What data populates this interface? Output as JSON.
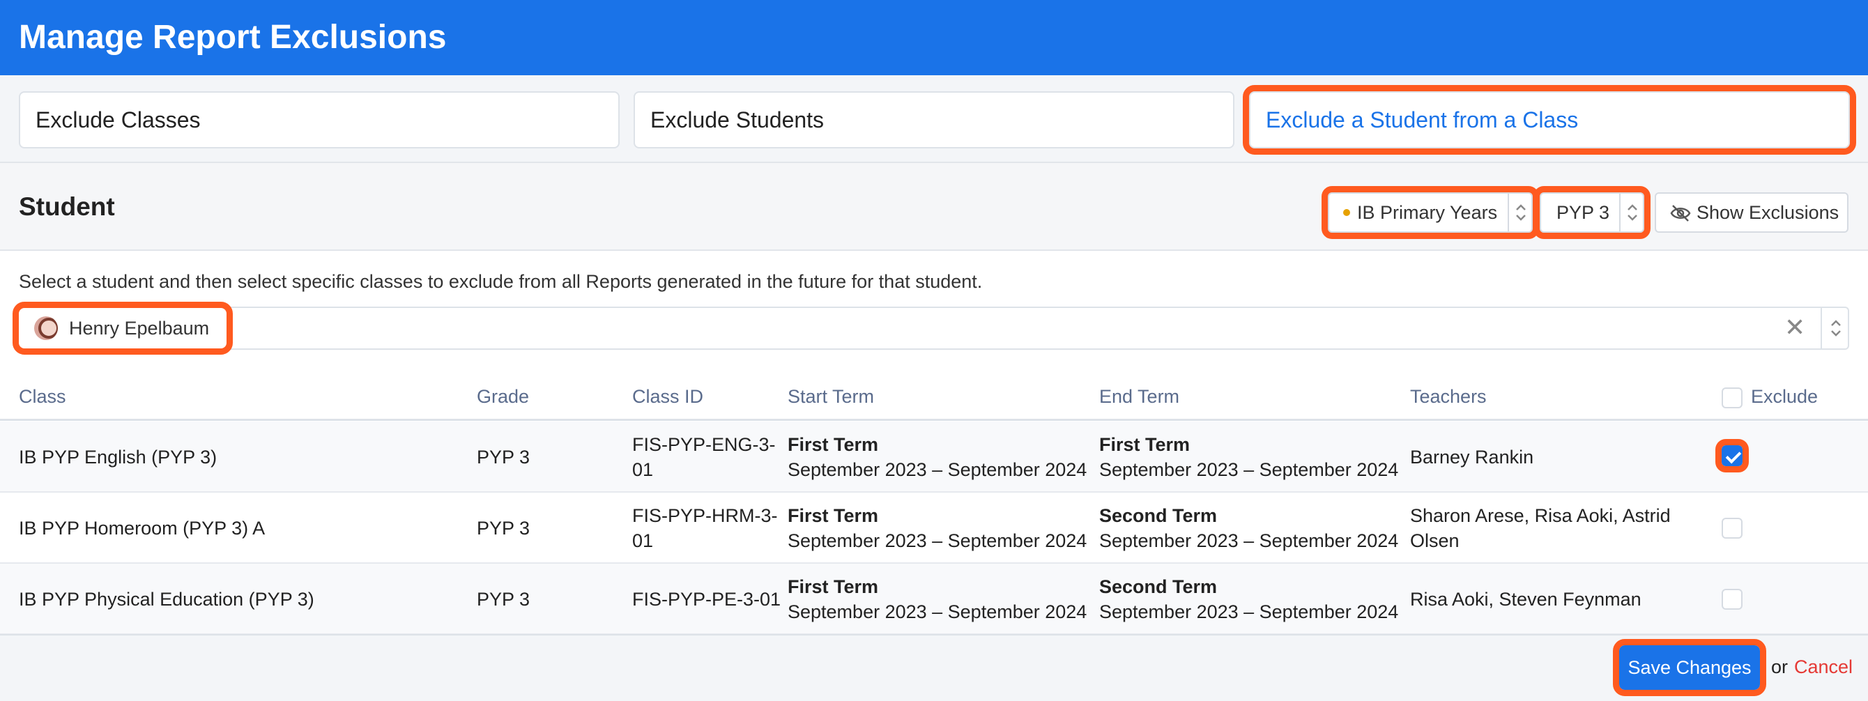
{
  "header": {
    "title": "Manage Report Exclusions"
  },
  "tabs": [
    {
      "label": "Exclude Classes",
      "active": false
    },
    {
      "label": "Exclude Students",
      "active": false
    },
    {
      "label": "Exclude a Student from a Class",
      "active": true
    }
  ],
  "section": {
    "title": "Student",
    "program_select": "IB Primary Years",
    "grade_select": "PYP 3",
    "show_exclusions_label": "Show Exclusions",
    "description": "Select a student and then select specific classes to exclude from all Reports generated in the future for that student.",
    "selected_student": "Henry Epelbaum"
  },
  "table": {
    "headers": {
      "class": "Class",
      "grade": "Grade",
      "class_id": "Class ID",
      "start_term": "Start Term",
      "end_term": "End Term",
      "teachers": "Teachers",
      "exclude": "Exclude"
    },
    "rows": [
      {
        "class": "IB PYP English (PYP 3)",
        "grade": "PYP 3",
        "class_id_1": "FIS-PYP-ENG-3-",
        "class_id_2": "01",
        "start_term_name": "First Term",
        "start_term_range": "September 2023 – September 2024",
        "end_term_name": "First Term",
        "end_term_range": "September 2023 – September 2024",
        "teachers_1": "Barney Rankin",
        "teachers_2": "",
        "excluded": true
      },
      {
        "class": "IB PYP Homeroom (PYP 3) A",
        "grade": "PYP 3",
        "class_id_1": "FIS-PYP-HRM-3-",
        "class_id_2": "01",
        "start_term_name": "First Term",
        "start_term_range": "September 2023 – September 2024",
        "end_term_name": "Second Term",
        "end_term_range": "September 2023 – September 2024",
        "teachers_1": "Sharon Arese, Risa Aoki, Astrid",
        "teachers_2": "Olsen",
        "excluded": false
      },
      {
        "class": "IB PYP Physical Education (PYP 3)",
        "grade": "PYP 3",
        "class_id_1": "FIS-PYP-PE-3-01",
        "class_id_2": "",
        "start_term_name": "First Term",
        "start_term_range": "September 2023 – September 2024",
        "end_term_name": "Second Term",
        "end_term_range": "September 2023 – September 2024",
        "teachers_1": "Risa Aoki, Steven Feynman",
        "teachers_2": "",
        "excluded": false
      }
    ]
  },
  "footer": {
    "save_label": "Save Changes",
    "or_label": "or",
    "cancel_label": "Cancel"
  },
  "colors": {
    "primary": "#1a73e8",
    "highlight": "#ff5a1f",
    "cancel": "#e53935"
  }
}
